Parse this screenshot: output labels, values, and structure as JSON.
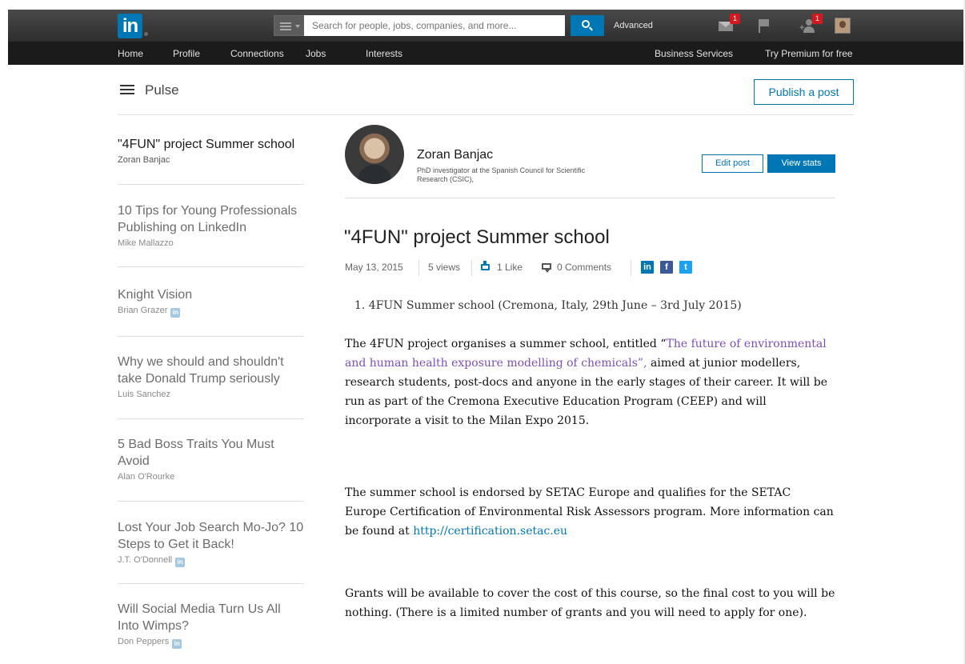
{
  "topbar": {
    "logo": "in",
    "search_placeholder": "Search for people, jobs, companies, and more...",
    "advanced_label": "Advanced",
    "messages_badge": "1",
    "connections_badge": "1"
  },
  "nav": {
    "items": [
      "Home",
      "Profile",
      "Connections",
      "Jobs",
      "Interests"
    ],
    "right": [
      "Business Services",
      "Try Premium for free"
    ]
  },
  "pulse": {
    "label": "Pulse",
    "publish_label": "Publish a post"
  },
  "sidebar": {
    "items": [
      {
        "title": "\"4FUN\" project Summer school",
        "author": "Zoran Banjac"
      },
      {
        "title": "10 Tips for Young Professionals Publishing on LinkedIn",
        "author": "Mike Mallazzo"
      },
      {
        "title": "Knight Vision",
        "author": "Brian Grazer"
      },
      {
        "title": "Why we should and shouldn't take Donald Trump seriously",
        "author": "Luis Sanchez"
      },
      {
        "title": "5 Bad Boss Traits You Must Avoid",
        "author": "Alan O'Rourke"
      },
      {
        "title": "Lost Your Job Search Mo-Jo? 10 Steps to Get it Back!",
        "author": "J.T. O'Donnell"
      },
      {
        "title": "Will Social Media Turn Us All Into Wimps?",
        "author": "Don Peppers"
      }
    ],
    "in_badge": "in"
  },
  "author": {
    "name": "Zoran Banjac",
    "desc": "PhD investigator at the Spanish Council for Scientific Research (CSIC),",
    "edit_label": "Edit post",
    "stats_label": "View stats"
  },
  "article": {
    "title": "\"4FUN\" project Summer school",
    "date": "May 13, 2015",
    "views": "5 views",
    "likes": "1 Like",
    "comments": "0 Comments",
    "share": {
      "linkedin": "in",
      "facebook": "f",
      "twitter": "t"
    },
    "list_item": "1.  4FUN Summer school (Cremona, Italy, 29th June – 3rd July 2015)",
    "p1_a": "The 4FUN project organises a summer school, entitled “",
    "p1_link": "The future of environmental and human health exposure modelling of chemicals”,",
    "p1_b": " aimed at junior modellers, research students, post-docs and anyone in the early stages of their career. It will be run as part of the Cremona Executive Education Program (CEEP) and will incorporate a visit to the Milan Expo 2015.",
    "p2_a": "The summer school is endorsed by SETAC Europe and qualifies for the SETAC Europe Certification of Environmental Risk Assessors program. More information can be found at ",
    "p2_link": "http://certification.setac.eu",
    "p3": "Grants will be available to cover the cost of this course, so the final cost to you will be nothing. (There is a limited number of grants and you will need to apply for one)."
  },
  "colors": {
    "brand": "#0077b5",
    "badge": "#d6181e",
    "link_purple": "#7d4eb8"
  }
}
